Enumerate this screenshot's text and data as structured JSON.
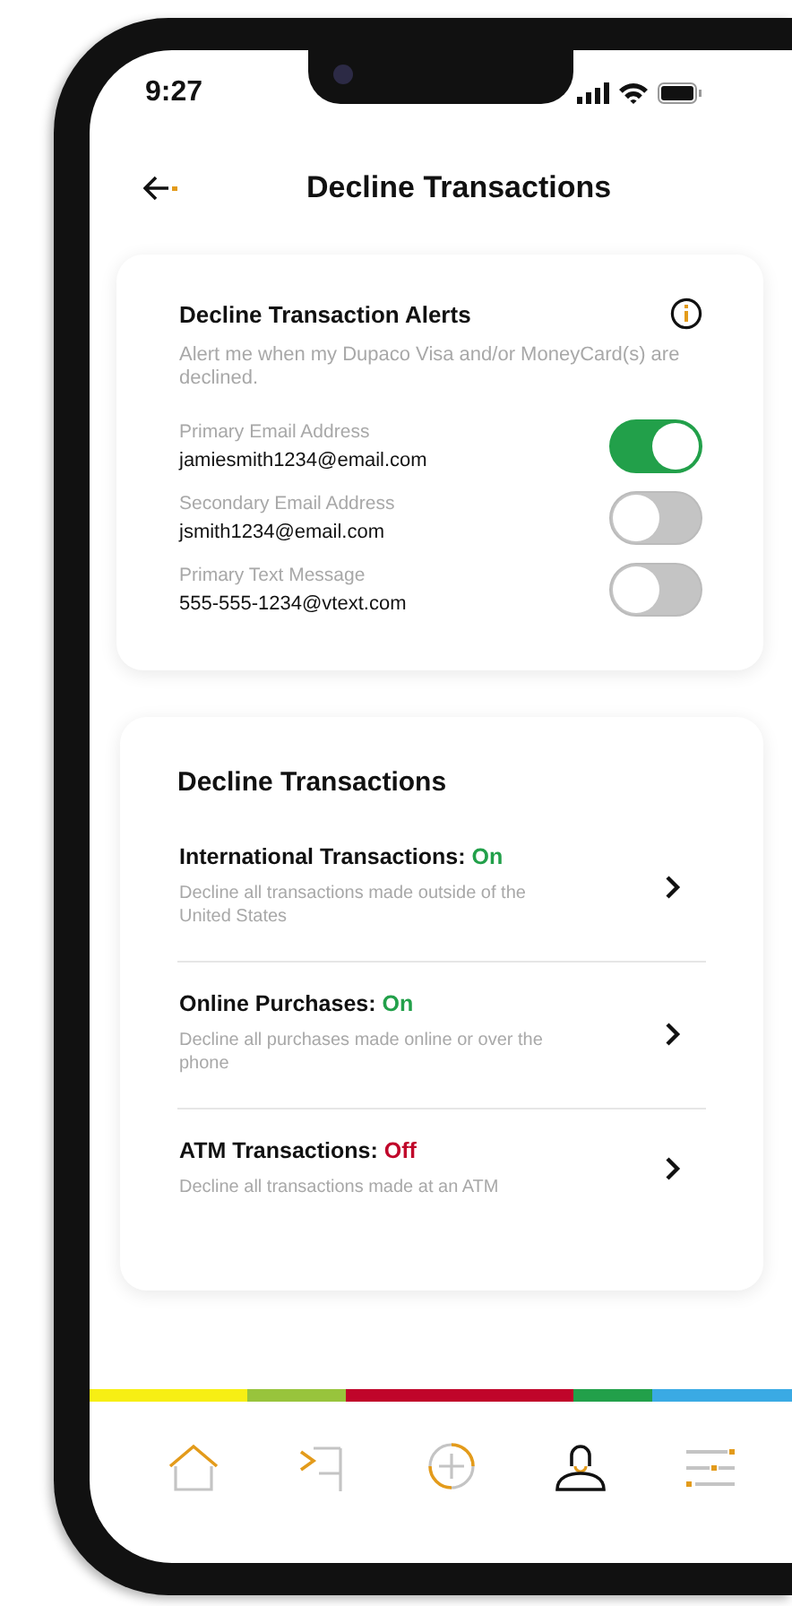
{
  "status_bar": {
    "time": "9:27"
  },
  "header": {
    "title": "Decline Transactions"
  },
  "alerts_card": {
    "title": "Decline Transaction Alerts",
    "description": "Alert me when my Dupaco Visa and/or MoneyCard(s) are declined.",
    "contacts": [
      {
        "label": "Primary Email Address",
        "value": "jamiesmith1234@email.com",
        "checked": true
      },
      {
        "label": "Secondary Email Address",
        "value": "jsmith1234@email.com",
        "checked": false
      },
      {
        "label": "Primary Text Message",
        "value": "555-555-1234@vtext.com",
        "checked": false
      }
    ]
  },
  "decline_card": {
    "title": "Decline Transactions",
    "items": [
      {
        "title": "International Transactions:",
        "status": "On",
        "on": true,
        "description": "Decline all transactions made outside of the United States"
      },
      {
        "title": "Online Purchases:",
        "status": "On",
        "on": true,
        "description": "Decline all purchases made online or over the phone"
      },
      {
        "title": "ATM Transactions:",
        "status": "Off",
        "on": false,
        "description": "Decline all transactions made at an ATM"
      }
    ]
  },
  "color_stripe": [
    {
      "color": "#f7ef14"
    },
    {
      "color": "#98c43c"
    },
    {
      "color": "#c0052a"
    },
    {
      "color": "#22a04a"
    },
    {
      "color": "#3aaae4"
    }
  ],
  "tab_bar": [
    {
      "kind": "home",
      "selected": false
    },
    {
      "kind": "transfer",
      "selected": false
    },
    {
      "kind": "add",
      "selected": false
    },
    {
      "kind": "profile",
      "selected": true
    },
    {
      "kind": "menu",
      "selected": false
    }
  ]
}
